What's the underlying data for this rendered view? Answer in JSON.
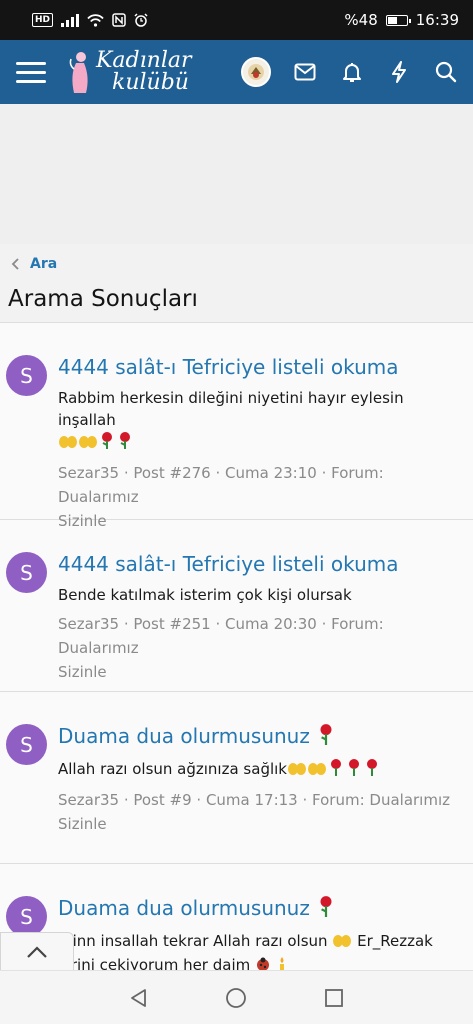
{
  "status_bar": {
    "hd": "HD",
    "battery": "%48",
    "time": "16:39"
  },
  "app": {
    "logo_line1": "Kadınlar",
    "logo_line2": "kulübü",
    "icons": [
      "menu-icon",
      "user-avatar",
      "mail-icon",
      "bell-icon",
      "bolt-icon",
      "search-icon"
    ]
  },
  "breadcrumb": {
    "label": "Ara"
  },
  "page": {
    "title": "Arama Sonuçları"
  },
  "results": [
    {
      "avatar_letter": "S",
      "title": "4444 salât-ı Tefriciye listeli okuma",
      "snippet": "Rabbim herkesin dileğini niyetini hayır eylesin inşallah",
      "meta_line1": "Sezar35 · Post #276 · Cuma 23:10 · Forum: Dualarımız",
      "meta_line2": "Sizinle"
    },
    {
      "avatar_letter": "S",
      "title": "4444 salât-ı Tefriciye listeli okuma",
      "snippet": "Bende katılmak isterim çok kişi olursak",
      "meta_line1": "Sezar35 · Post #251 · Cuma 20:30 · Forum: Dualarımız",
      "meta_line2": "Sizinle"
    },
    {
      "avatar_letter": "S",
      "title": "Duama dua olurmusunuz",
      "snippet": "Allah razı olsun ağzınıza sağlık",
      "meta_line1": "Sezar35 · Post #9 · Cuma 17:13 · Forum: Dualarımız",
      "meta_line2": "Sizinle"
    },
    {
      "avatar_letter": "S",
      "title": "Duama dua olurmusunuz",
      "snippet": "minn insallah tekrar Allah razı olsun",
      "snippet_tail": "Er_Rezzak",
      "snippet_line2": "kirini cekiyorum her daim"
    }
  ],
  "colors": {
    "header": "#1f5f93",
    "link": "#2577b1",
    "avatar": "#8f5fc4"
  }
}
